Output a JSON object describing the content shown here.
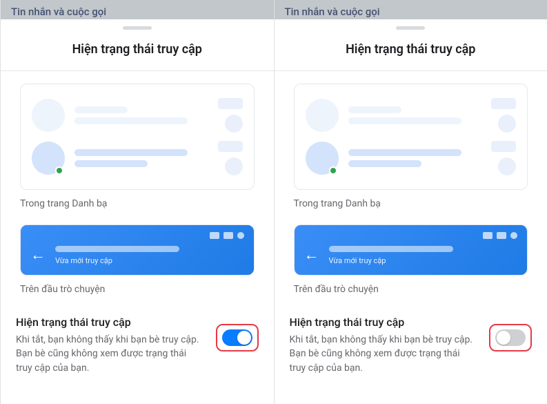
{
  "screens": [
    {
      "previous_header": "Tin nhắn và cuộc gọi",
      "panel_title": "Hiện trạng thái truy cập",
      "contacts_caption": "Trong trang Danh bạ",
      "chat_header_caption": "Trên đầu trò chuyện",
      "chat_active_label": "Vừa mới truy cập",
      "setting_title": "Hiện trạng thái truy cập",
      "setting_desc": "Khi tắt, bạn không thấy khi bạn bè truy cập. Bạn bè cũng không xem được trạng thái truy cập của bạn.",
      "toggle_state": "on"
    },
    {
      "previous_header": "Tin nhắn và cuộc gọi",
      "panel_title": "Hiện trạng thái truy cập",
      "contacts_caption": "Trong trang Danh bạ",
      "chat_header_caption": "Trên đầu trò chuyện",
      "chat_active_label": "Vừa mới truy cập",
      "setting_title": "Hiện trạng thái truy cập",
      "setting_desc": "Khi tắt, bạn không thấy khi bạn bè truy cập. Bạn bè cũng không xem được trạng thái truy cập của bạn.",
      "toggle_state": "off"
    }
  ],
  "colors": {
    "accent": "#0a7cff",
    "highlight_border": "#e63946",
    "active_dot": "#31a24c"
  }
}
